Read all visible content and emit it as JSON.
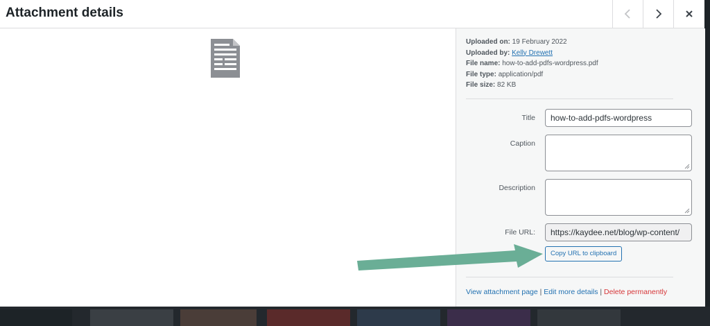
{
  "modal": {
    "title": "Attachment details"
  },
  "meta": {
    "uploaded_on_label": "Uploaded on:",
    "uploaded_on": "19 February 2022",
    "uploaded_by_label": "Uploaded by:",
    "uploaded_by": "Kelly Drewett",
    "file_name_label": "File name:",
    "file_name": "how-to-add-pdfs-wordpress.pdf",
    "file_type_label": "File type:",
    "file_type": "application/pdf",
    "file_size_label": "File size:",
    "file_size": "82 KB"
  },
  "fields": {
    "title_label": "Title",
    "title_value": "how-to-add-pdfs-wordpress",
    "caption_label": "Caption",
    "caption_value": "",
    "description_label": "Description",
    "description_value": "",
    "file_url_label": "File URL:",
    "file_url_value": "https://kaydee.net/blog/wp-content/"
  },
  "copy_button_label": "Copy URL to clipboard",
  "actions": {
    "view": "View attachment page",
    "sep1": " | ",
    "edit": "Edit more details",
    "sep2": " | ",
    "delete": "Delete permanently"
  },
  "colors": {
    "accent": "#2271b1",
    "danger": "#d63638",
    "annotation_arrow": "#6aae96"
  },
  "icons": {
    "prev": "chevron-left-icon",
    "next": "chevron-right-icon",
    "close": "close-icon",
    "document": "document-icon"
  }
}
